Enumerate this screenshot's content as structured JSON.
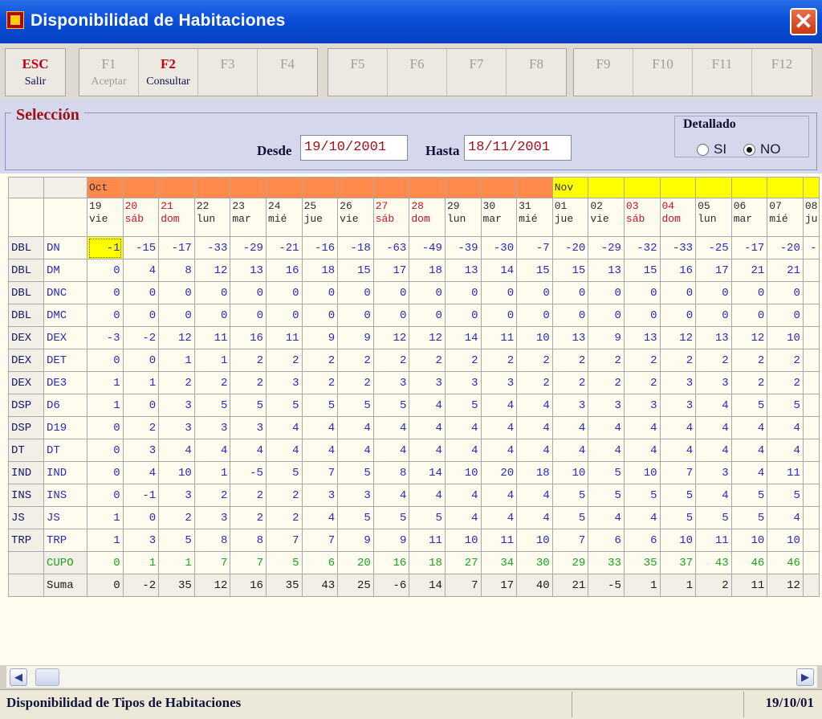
{
  "window": {
    "title": "Disponibilidad de Habitaciones",
    "close_icon": "close-icon"
  },
  "toolbar": {
    "buttons": [
      {
        "key": "ESC",
        "label": "Salir",
        "enabled": true
      },
      {
        "key": "F1",
        "label": "Aceptar",
        "enabled": false
      },
      {
        "key": "F2",
        "label": "Consultar",
        "enabled": true
      },
      {
        "key": "F3",
        "label": "",
        "enabled": false
      },
      {
        "key": "F4",
        "label": "",
        "enabled": false
      },
      {
        "key": "F5",
        "label": "",
        "enabled": false
      },
      {
        "key": "F6",
        "label": "",
        "enabled": false
      },
      {
        "key": "F7",
        "label": "",
        "enabled": false
      },
      {
        "key": "F8",
        "label": "",
        "enabled": false
      },
      {
        "key": "F9",
        "label": "",
        "enabled": false
      },
      {
        "key": "F10",
        "label": "",
        "enabled": false
      },
      {
        "key": "F11",
        "label": "",
        "enabled": false
      },
      {
        "key": "F12",
        "label": "",
        "enabled": false
      }
    ]
  },
  "selection": {
    "title": "Selección",
    "desde_label": "Desde",
    "desde_value": "19/10/2001",
    "hasta_label": "Hasta",
    "hasta_value": "18/11/2001",
    "detallado_label": "Detallado",
    "options": [
      "SI",
      "NO"
    ],
    "selected": "NO"
  },
  "grid": {
    "months": {
      "oct": "Oct",
      "nov": "Nov"
    },
    "days": [
      {
        "d": "19",
        "w": "vie",
        "m": "oct",
        "we": false
      },
      {
        "d": "20",
        "w": "sáb",
        "m": "oct",
        "we": true
      },
      {
        "d": "21",
        "w": "dom",
        "m": "oct",
        "we": true
      },
      {
        "d": "22",
        "w": "lun",
        "m": "oct",
        "we": false
      },
      {
        "d": "23",
        "w": "mar",
        "m": "oct",
        "we": false
      },
      {
        "d": "24",
        "w": "mié",
        "m": "oct",
        "we": false
      },
      {
        "d": "25",
        "w": "jue",
        "m": "oct",
        "we": false
      },
      {
        "d": "26",
        "w": "vie",
        "m": "oct",
        "we": false
      },
      {
        "d": "27",
        "w": "sáb",
        "m": "oct",
        "we": true
      },
      {
        "d": "28",
        "w": "dom",
        "m": "oct",
        "we": true
      },
      {
        "d": "29",
        "w": "lun",
        "m": "oct",
        "we": false
      },
      {
        "d": "30",
        "w": "mar",
        "m": "oct",
        "we": false
      },
      {
        "d": "31",
        "w": "mié",
        "m": "oct",
        "we": false
      },
      {
        "d": "01",
        "w": "jue",
        "m": "nov",
        "we": false
      },
      {
        "d": "02",
        "w": "vie",
        "m": "nov",
        "we": false
      },
      {
        "d": "03",
        "w": "sáb",
        "m": "nov",
        "we": true
      },
      {
        "d": "04",
        "w": "dom",
        "m": "nov",
        "we": true
      },
      {
        "d": "05",
        "w": "lun",
        "m": "nov",
        "we": false
      },
      {
        "d": "06",
        "w": "mar",
        "m": "nov",
        "we": false
      },
      {
        "d": "07",
        "w": "mié",
        "m": "nov",
        "we": false
      },
      {
        "d": "08",
        "w": "ju",
        "m": "nov",
        "we": false
      }
    ],
    "rows": [
      {
        "tipo": "DBL",
        "sub": "DN",
        "vals": [
          "-1",
          "-15",
          "-17",
          "-33",
          "-29",
          "-21",
          "-16",
          "-18",
          "-63",
          "-49",
          "-39",
          "-30",
          "-7",
          "-20",
          "-29",
          "-32",
          "-33",
          "-25",
          "-17",
          "-20",
          "-"
        ]
      },
      {
        "tipo": "DBL",
        "sub": "DM",
        "vals": [
          "0",
          "4",
          "8",
          "12",
          "13",
          "16",
          "18",
          "15",
          "17",
          "18",
          "13",
          "14",
          "15",
          "15",
          "13",
          "15",
          "16",
          "17",
          "21",
          "21",
          ""
        ]
      },
      {
        "tipo": "DBL",
        "sub": "DNC",
        "vals": [
          "0",
          "0",
          "0",
          "0",
          "0",
          "0",
          "0",
          "0",
          "0",
          "0",
          "0",
          "0",
          "0",
          "0",
          "0",
          "0",
          "0",
          "0",
          "0",
          "0",
          ""
        ]
      },
      {
        "tipo": "DBL",
        "sub": "DMC",
        "vals": [
          "0",
          "0",
          "0",
          "0",
          "0",
          "0",
          "0",
          "0",
          "0",
          "0",
          "0",
          "0",
          "0",
          "0",
          "0",
          "0",
          "0",
          "0",
          "0",
          "0",
          ""
        ]
      },
      {
        "tipo": "DEX",
        "sub": "DEX",
        "vals": [
          "-3",
          "-2",
          "12",
          "11",
          "16",
          "11",
          "9",
          "9",
          "12",
          "12",
          "14",
          "11",
          "10",
          "13",
          "9",
          "13",
          "12",
          "13",
          "12",
          "10",
          ""
        ]
      },
      {
        "tipo": "DEX",
        "sub": "DET",
        "vals": [
          "0",
          "0",
          "1",
          "1",
          "2",
          "2",
          "2",
          "2",
          "2",
          "2",
          "2",
          "2",
          "2",
          "2",
          "2",
          "2",
          "2",
          "2",
          "2",
          "2",
          ""
        ]
      },
      {
        "tipo": "DEX",
        "sub": "DE3",
        "vals": [
          "1",
          "1",
          "2",
          "2",
          "2",
          "3",
          "2",
          "2",
          "3",
          "3",
          "3",
          "3",
          "2",
          "2",
          "2",
          "2",
          "3",
          "3",
          "2",
          "2",
          ""
        ]
      },
      {
        "tipo": "DSP",
        "sub": "D6",
        "vals": [
          "1",
          "0",
          "3",
          "5",
          "5",
          "5",
          "5",
          "5",
          "5",
          "4",
          "5",
          "4",
          "4",
          "3",
          "3",
          "3",
          "3",
          "4",
          "5",
          "5",
          ""
        ]
      },
      {
        "tipo": "DSP",
        "sub": "D19",
        "vals": [
          "0",
          "2",
          "3",
          "3",
          "3",
          "4",
          "4",
          "4",
          "4",
          "4",
          "4",
          "4",
          "4",
          "4",
          "4",
          "4",
          "4",
          "4",
          "4",
          "4",
          ""
        ]
      },
      {
        "tipo": "DT",
        "sub": "DT",
        "vals": [
          "0",
          "3",
          "4",
          "4",
          "4",
          "4",
          "4",
          "4",
          "4",
          "4",
          "4",
          "4",
          "4",
          "4",
          "4",
          "4",
          "4",
          "4",
          "4",
          "4",
          ""
        ]
      },
      {
        "tipo": "IND",
        "sub": "IND",
        "vals": [
          "0",
          "4",
          "10",
          "1",
          "-5",
          "5",
          "7",
          "5",
          "8",
          "14",
          "10",
          "20",
          "18",
          "10",
          "5",
          "10",
          "7",
          "3",
          "4",
          "11",
          ""
        ]
      },
      {
        "tipo": "INS",
        "sub": "INS",
        "vals": [
          "0",
          "-1",
          "3",
          "2",
          "2",
          "2",
          "3",
          "3",
          "4",
          "4",
          "4",
          "4",
          "4",
          "5",
          "5",
          "5",
          "5",
          "4",
          "5",
          "5",
          ""
        ]
      },
      {
        "tipo": "JS",
        "sub": "JS",
        "vals": [
          "1",
          "0",
          "2",
          "3",
          "2",
          "2",
          "4",
          "5",
          "5",
          "5",
          "4",
          "4",
          "4",
          "5",
          "4",
          "4",
          "5",
          "5",
          "5",
          "4",
          ""
        ]
      },
      {
        "tipo": "TRP",
        "sub": "TRP",
        "vals": [
          "1",
          "3",
          "5",
          "8",
          "8",
          "7",
          "7",
          "9",
          "9",
          "11",
          "10",
          "11",
          "10",
          "7",
          "6",
          "6",
          "10",
          "11",
          "10",
          "10",
          ""
        ]
      }
    ],
    "cupo": {
      "label": "CUPO",
      "vals": [
        "0",
        "1",
        "1",
        "7",
        "7",
        "5",
        "6",
        "20",
        "16",
        "18",
        "27",
        "34",
        "30",
        "29",
        "33",
        "35",
        "37",
        "43",
        "46",
        "46",
        ""
      ]
    },
    "suma": {
      "label": "Suma",
      "vals": [
        "0",
        "-2",
        "35",
        "12",
        "16",
        "35",
        "43",
        "25",
        "-6",
        "14",
        "7",
        "17",
        "40",
        "21",
        "-5",
        "1",
        "1",
        "2",
        "11",
        "12",
        ""
      ]
    }
  },
  "scrollbar": {
    "left_icon": "arrow-left-icon",
    "right_icon": "arrow-right-icon"
  },
  "status": {
    "text": "Disponibilidad de Tipos de Habitaciones",
    "date": "19/10/01"
  }
}
